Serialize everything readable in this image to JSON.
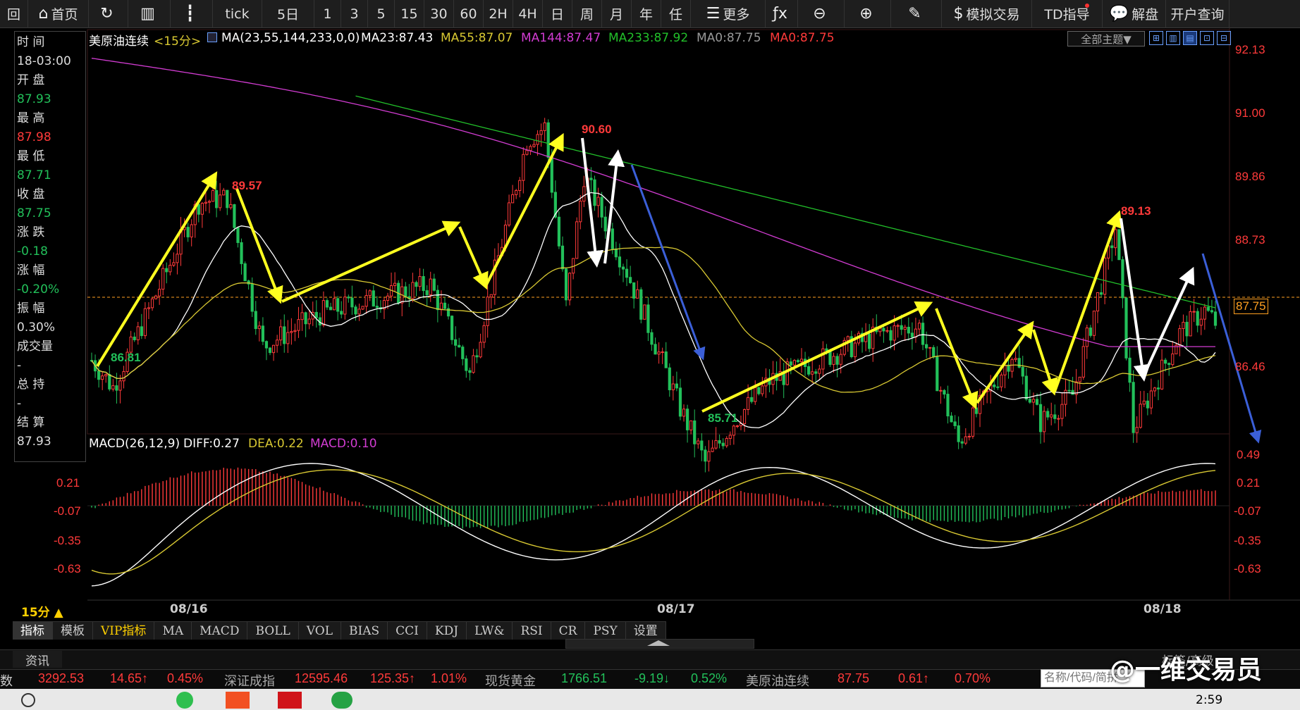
{
  "toolbar": {
    "items": [
      {
        "label": "回",
        "icon": "",
        "name": "back-button"
      },
      {
        "label": "首页",
        "icon": "⌂",
        "name": "home-button"
      },
      {
        "label": "",
        "icon": "↻",
        "name": "refresh-button"
      },
      {
        "label": "",
        "icon": "▥",
        "name": "kline-icon-button"
      },
      {
        "label": "",
        "icon": "┇",
        "name": "candle-icon-button"
      },
      {
        "label": "tick",
        "icon": "",
        "name": "period-tick"
      },
      {
        "label": "5日",
        "icon": "",
        "name": "period-5day"
      },
      {
        "label": "1",
        "icon": "",
        "name": "period-1"
      },
      {
        "label": "3",
        "icon": "",
        "name": "period-3"
      },
      {
        "label": "5",
        "icon": "",
        "name": "period-5"
      },
      {
        "label": "15",
        "icon": "",
        "name": "period-15"
      },
      {
        "label": "30",
        "icon": "",
        "name": "period-30"
      },
      {
        "label": "60",
        "icon": "",
        "name": "period-60"
      },
      {
        "label": "2H",
        "icon": "",
        "name": "period-2h"
      },
      {
        "label": "4H",
        "icon": "",
        "name": "period-4h"
      },
      {
        "label": "日",
        "icon": "",
        "name": "period-day"
      },
      {
        "label": "周",
        "icon": "",
        "name": "period-week"
      },
      {
        "label": "月",
        "icon": "",
        "name": "period-month"
      },
      {
        "label": "年",
        "icon": "",
        "name": "period-year"
      },
      {
        "label": "任",
        "icon": "",
        "name": "period-custom"
      },
      {
        "label": "更多",
        "icon": "☰",
        "name": "more-button"
      },
      {
        "label": "",
        "icon": "ƒx",
        "name": "formula-button"
      },
      {
        "label": "",
        "icon": "⊖",
        "name": "zoom-out-button"
      },
      {
        "label": "",
        "icon": "⊕",
        "name": "zoom-in-button"
      },
      {
        "label": "",
        "icon": "✎",
        "name": "draw-button"
      },
      {
        "label": "模拟交易",
        "icon": "$",
        "name": "sim-trade-button"
      },
      {
        "label": "TD指导",
        "icon": "",
        "name": "td-guide-button"
      },
      {
        "label": "解盘",
        "icon": "💬",
        "name": "analysis-button"
      },
      {
        "label": "开户查询",
        "icon": "",
        "name": "account-query-button"
      }
    ]
  },
  "info_panel": {
    "time_label": "时 间",
    "time_value": "18-03:00",
    "open_label": "开 盘",
    "open_value": "87.93",
    "high_label": "最 高",
    "high_value": "87.98",
    "low_label": "最 低",
    "low_value": "87.71",
    "close_label": "收 盘",
    "close_value": "87.75",
    "change_label": "涨 跌",
    "change_value": "-0.18",
    "change_pct_label": "涨 幅",
    "change_pct_value": "-0.20%",
    "amplitude_label": "振 幅",
    "amplitude_value": "0.30%",
    "volume_label": "成交量",
    "volume_value": "-",
    "open_interest_label": "总 持",
    "open_interest_value": "-",
    "settle_label": "结 算",
    "settle_value": "87.93"
  },
  "price_legend": {
    "instrument": "美原油连续",
    "period": "<15分>",
    "ma_params": "MA(23,55,144,233,0,0)",
    "ma23": "MA23:87.43",
    "ma55": "MA55:87.07",
    "ma144": "MA144:87.47",
    "ma233": "MA233:87.92",
    "ma0a": "MA0:87.75",
    "ma0b": "MA0:87.75"
  },
  "theme_selector": "全部主题▼",
  "price_axis": [
    "92.13",
    "91.00",
    "89.86",
    "88.73",
    "87.75",
    "86.46"
  ],
  "price_annotations": {
    "low_start": "86.81",
    "high_1": "89.57",
    "high_2": "90.60",
    "low_2": "85.71",
    "high_3": "89.13"
  },
  "macd_legend": {
    "params": "MACD(26,12,9)",
    "diff": "DIFF:0.27",
    "dea": "DEA:0.22",
    "macd": "MACD:0.10"
  },
  "macd_axis_left": [
    "0.21",
    "-0.07",
    "-0.35",
    "-0.63"
  ],
  "macd_axis_right": [
    "0.49",
    "0.21",
    "-0.07",
    "-0.35",
    "-0.63"
  ],
  "period_button": "15分 ▲",
  "dates": [
    "08/16",
    "08/17",
    "08/18"
  ],
  "indicator_tabs": [
    "指标",
    "模板",
    "VIP指标",
    "MA",
    "MACD",
    "BOLL",
    "VOL",
    "BIAS",
    "CCI",
    "KDJ",
    "LW&",
    "RSI",
    "CR",
    "PSY",
    "设置"
  ],
  "news_tab": "资讯",
  "tag_text": "标签/高级",
  "ticker": {
    "prefix": "数",
    "sh_value": "3292.53",
    "sh_change": "14.65↑",
    "sh_pct": "0.45%",
    "sz_name": "深证成指",
    "sz_value": "12595.46",
    "sz_change": "125.35↑",
    "sz_pct": "1.01%",
    "gold_name": "现货黄金",
    "gold_value": "1766.51",
    "gold_change": "-9.19↓",
    "gold_pct": "0.52%",
    "oil_name": "美原油连续",
    "oil_value": "87.75",
    "oil_change": "0.61↑",
    "oil_pct": "0.70%"
  },
  "search_placeholder": "名称/代码/简拼",
  "watermark": "@一维交易员",
  "clock": "2:59",
  "colors": {
    "up": "#ff3a3a",
    "down": "#22c05a",
    "ma23": "#ffffff",
    "ma55": "#d8c832",
    "ma144": "#d23cd2",
    "ma233": "#22c02a",
    "arrow_yellow": "#ffff20",
    "arrow_white": "#ffffff",
    "arrow_blue": "#3b5fd8"
  }
}
